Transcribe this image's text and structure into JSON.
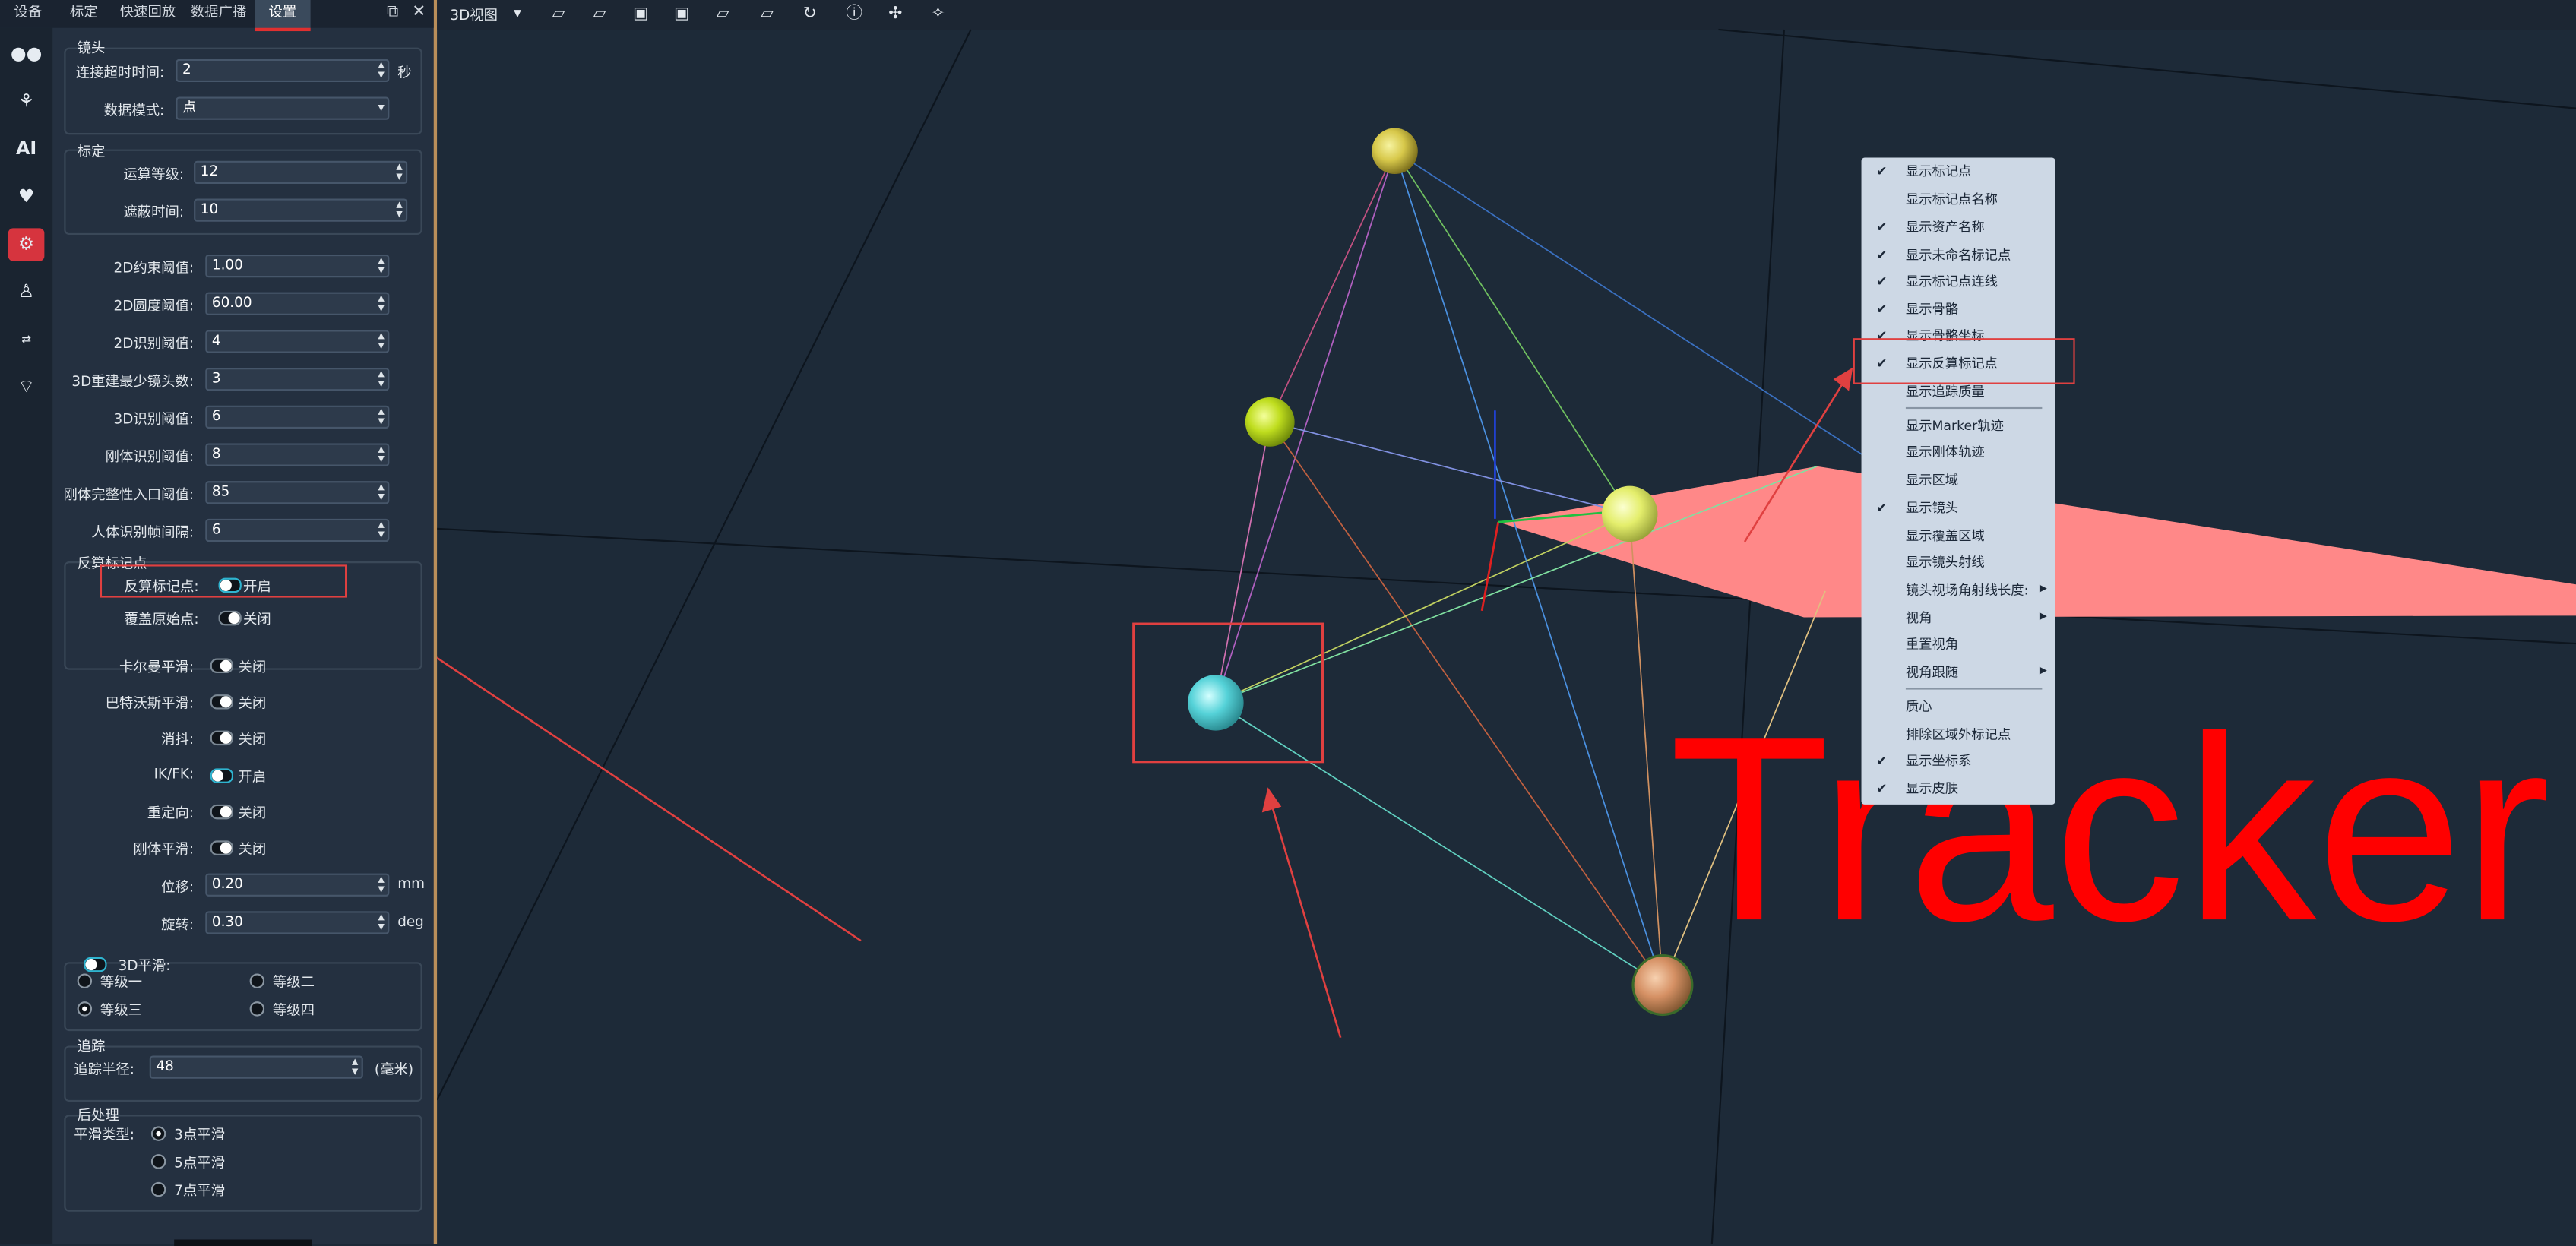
{
  "tabs": {
    "items": [
      "设备",
      "标定",
      "快速回放",
      "数据广播",
      "设置"
    ]
  },
  "camera": {
    "title": "镜头",
    "timeout_label": "连接超时时间:",
    "timeout_value": "2",
    "timeout_unit": "秒",
    "mode_label": "数据模式:",
    "mode_value": "点"
  },
  "calib": {
    "title": "标定",
    "level_label": "运算等级:",
    "level_value": "12",
    "mask_label": "遮蔽时间:",
    "mask_value": "10"
  },
  "params": {
    "items": [
      {
        "label": "2D约束阈值:",
        "value": "1.00"
      },
      {
        "label": "2D圆度阈值:",
        "value": "60.00"
      },
      {
        "label": "2D识别阈值:",
        "value": "4"
      },
      {
        "label": "3D重建最少镜头数:",
        "value": "3"
      },
      {
        "label": "3D识别阈值:",
        "value": "6"
      },
      {
        "label": "刚体识别阈值:",
        "value": "8"
      },
      {
        "label": "刚体完整性入口阈值:",
        "value": "85"
      },
      {
        "label": "人体识别帧间隔:",
        "value": "6"
      }
    ]
  },
  "inverse": {
    "title": "反算标记点",
    "label": "反算标记点:",
    "state": "开启",
    "cover_label": "覆盖原始点:",
    "cover_state": "关闭"
  },
  "toggles": {
    "items": [
      {
        "label": "卡尔曼平滑:",
        "state": "关闭",
        "on": false
      },
      {
        "label": "巴特沃斯平滑:",
        "state": "关闭",
        "on": false
      },
      {
        "label": "消抖:",
        "state": "关闭",
        "on": false
      },
      {
        "label": "IK/FK:",
        "state": "开启",
        "on": true
      },
      {
        "label": "重定向:",
        "state": "关闭",
        "on": false
      },
      {
        "label": "刚体平滑:",
        "state": "关闭",
        "on": false
      }
    ]
  },
  "offset": {
    "label": "位移:",
    "value": "0.20",
    "unit": "mm"
  },
  "rotate": {
    "label": "旋转:",
    "value": "0.30",
    "unit": "deg"
  },
  "smooth3d": {
    "title": "3D平滑:",
    "levels": [
      "等级一",
      "等级二",
      "等级三",
      "等级四"
    ],
    "selected": "等级三"
  },
  "track": {
    "title": "追踪",
    "label": "追踪半径:",
    "value": "48",
    "unit": "(毫米)"
  },
  "post": {
    "title": "后处理",
    "label": "平滑类型:",
    "options": [
      "3点平滑",
      "5点平滑",
      "7点平滑"
    ],
    "selected": "3点平滑"
  },
  "viewport": {
    "view_label": "3D视图",
    "watermark": "Tracker"
  },
  "menu": {
    "items": [
      {
        "label": "显示标记点",
        "checked": true
      },
      {
        "label": "显示标记点名称",
        "checked": false
      },
      {
        "label": "显示资产名称",
        "checked": true
      },
      {
        "label": "显示未命名标记点",
        "checked": true
      },
      {
        "label": "显示标记点连线",
        "checked": true
      },
      {
        "label": "显示骨骼",
        "checked": true
      },
      {
        "label": "显示骨骼坐标",
        "checked": true
      },
      {
        "label": "显示反算标记点",
        "checked": true
      },
      {
        "label": "显示追踪质量",
        "checked": false
      },
      {
        "label": "显示Marker轨迹",
        "checked": false
      },
      {
        "label": "显示刚体轨迹",
        "checked": false
      },
      {
        "label": "显示区域",
        "checked": false
      },
      {
        "label": "显示镜头",
        "checked": true
      },
      {
        "label": "显示覆盖区域",
        "checked": false
      },
      {
        "label": "显示镜头射线",
        "checked": false
      },
      {
        "label": "镜头视场角射线长度:",
        "checked": false,
        "submenu": true
      },
      {
        "label": "视角",
        "checked": false,
        "submenu": true
      },
      {
        "label": "重置视角",
        "checked": false
      },
      {
        "label": "视角跟随",
        "checked": false,
        "submenu": true
      },
      {
        "label": "质心",
        "checked": false
      },
      {
        "label": "排除区域外标记点",
        "checked": false
      },
      {
        "label": "显示坐标系",
        "checked": true
      },
      {
        "label": "显示皮肤",
        "checked": true
      }
    ]
  },
  "colors": {
    "accent": "#d6343e",
    "panel": "#243040",
    "viewport": "#1d2a38",
    "menu": "#cdd8e5",
    "highlight": "#e04040"
  }
}
